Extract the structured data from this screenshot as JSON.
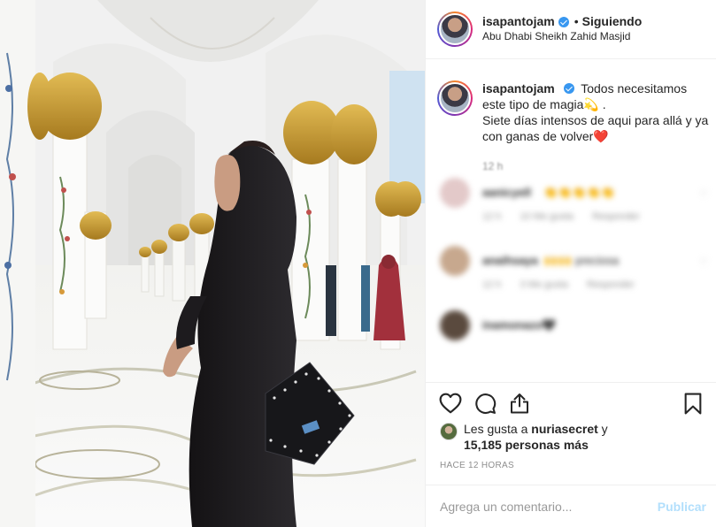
{
  "post": {
    "username": "isapantojam",
    "follow_status": "Siguiendo",
    "separator": "•",
    "location": "Abu Dhabi Sheikh Zahid Masjid",
    "caption_line1": "Todos necesitamos este tipo de magia💫 .",
    "caption_line2": "Siete días intensos de aqui para allá y ya con ganas de volver❤️",
    "caption_time": "12 h"
  },
  "comments": [
    {
      "name": "aanicyell",
      "text": "👏👏👏👏👏",
      "time": "12 h",
      "likes": "10 Me gusta",
      "reply": "Responder",
      "avatar_color": "#e3c9c9"
    },
    {
      "name": "anaihsaya",
      "text": "🙌🙌 preciosa",
      "time": "12 h",
      "likes": "3 Me gusta",
      "reply": "Responder",
      "avatar_color": "#c7a88e"
    },
    {
      "name": "inamonazo",
      "text": "🖤",
      "time": "",
      "likes": "",
      "reply": "",
      "avatar_color": "#5a4a3e"
    }
  ],
  "actions": {
    "like_icon": "heart-icon",
    "comment_icon": "comment-icon",
    "share_icon": "share-icon",
    "save_icon": "bookmark-icon"
  },
  "likes": {
    "prefix": "Les gusta a",
    "user": "nuriasecret",
    "conj": "y",
    "count": "15,185 personas más"
  },
  "timestamp": "HACE 12 HORAS",
  "add_comment": {
    "placeholder": "Agrega un comentario...",
    "publish": "Publicar"
  },
  "colors": {
    "accent_blue": "#3897f0",
    "publish_disabled": "#b2dffc",
    "gold": "#c99a2e"
  }
}
